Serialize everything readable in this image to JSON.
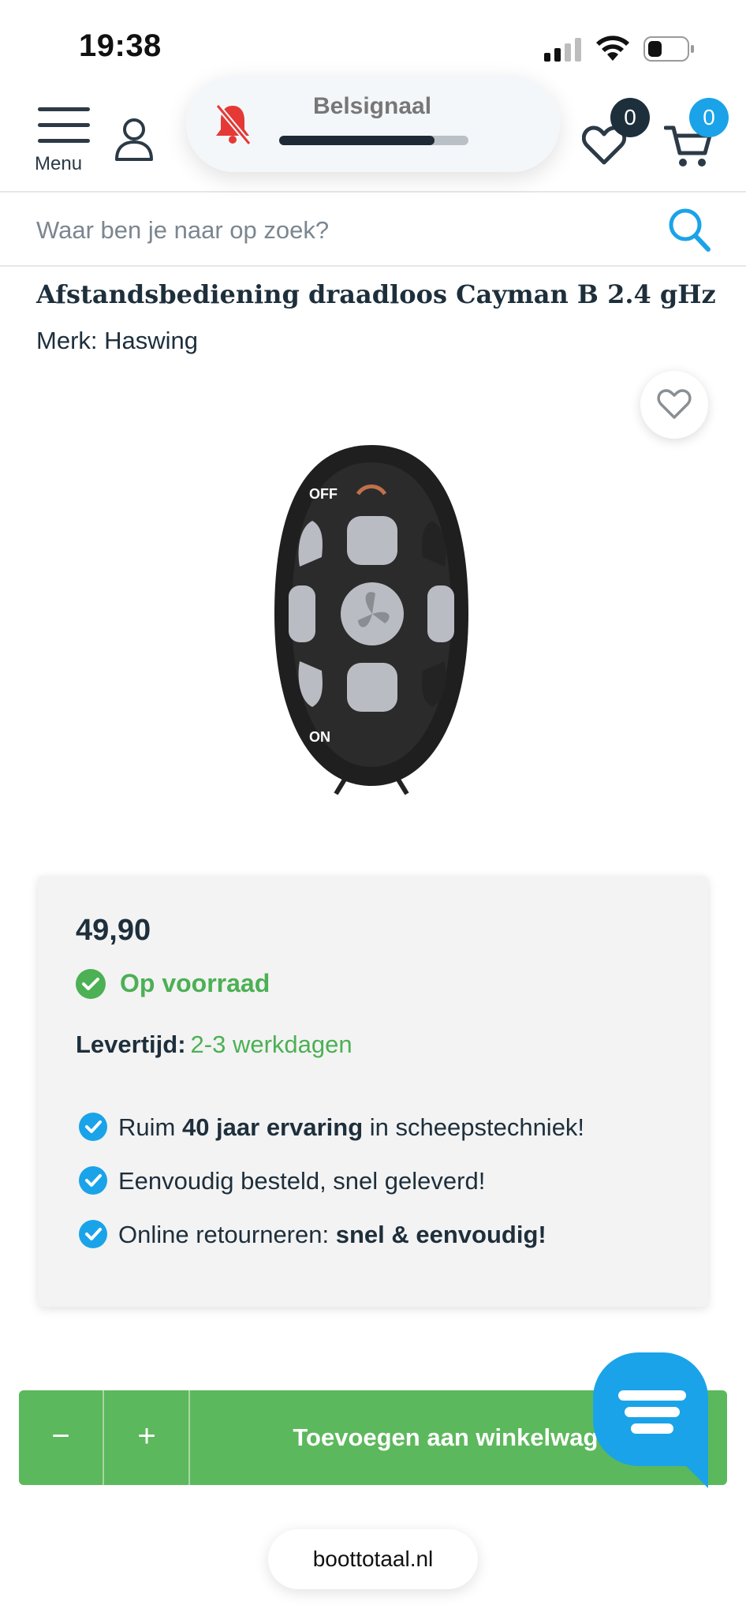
{
  "status_bar": {
    "time": "19:38",
    "icons": [
      "cellular-signal-icon",
      "wifi-icon",
      "battery-icon"
    ]
  },
  "header": {
    "menu_label": "Menu",
    "wishlist_count": "0",
    "cart_count": "0",
    "icons": [
      "hamburger-icon",
      "account-icon",
      "heart-icon",
      "cart-icon"
    ]
  },
  "overlay": {
    "title": "Belsignaal",
    "icon": "bell-muted-icon",
    "volume_level_fraction": 0.82
  },
  "search": {
    "placeholder": "Waar ben je naar op zoek?",
    "value": "",
    "icon": "search-icon"
  },
  "product": {
    "title": "Afstandsbediening draadloos Cayman B 2.4 gHz",
    "brand_line": "Merk: Haswing",
    "favorite_icon": "heart-outline-icon",
    "image_labels": {
      "off": "OFF",
      "on": "ON"
    }
  },
  "purchase": {
    "price": "49,90",
    "stock": "Op voorraad",
    "delivery_label": "Levertijd:",
    "delivery_value": "2-3 werkdagen",
    "usps": [
      {
        "pre": "Ruim ",
        "bold": "40 jaar ervaring",
        "post": " in scheepstechniek!"
      },
      {
        "pre": "Eenvoudig besteld, snel geleverd!",
        "bold": "",
        "post": ""
      },
      {
        "pre": "Online retourneren: ",
        "bold": "snel & eenvoudig!",
        "post": ""
      }
    ]
  },
  "cart_bar": {
    "minus_label": "−",
    "plus_label": "+",
    "add_label": "Toevoegen aan winkelwagen"
  },
  "footer": {
    "url": "boottotaal.nl"
  },
  "colors": {
    "primary_text": "#1e2f3c",
    "accent_blue": "#1aa3e8",
    "success_green": "#4cb054",
    "cart_button_green": "#5cb85c",
    "panel_background": "#f3f3f3",
    "muted_bell_red": "#e53935"
  }
}
